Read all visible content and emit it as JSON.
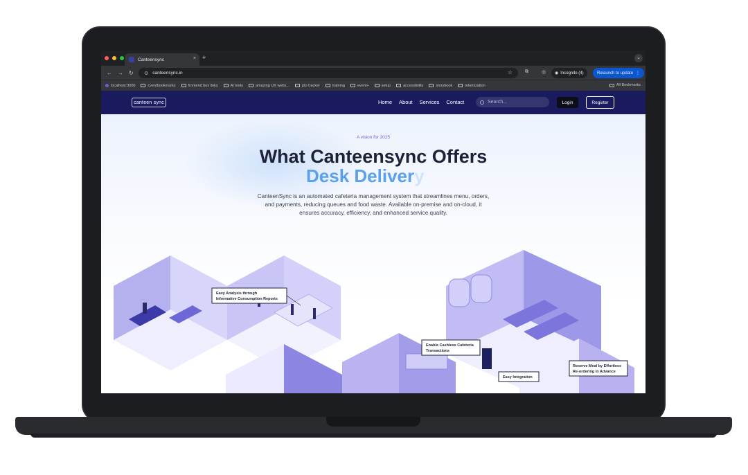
{
  "browser": {
    "tab_title": "Canteensync",
    "new_tab": "+",
    "tab_close": "×",
    "url": "canteensync.in",
    "incognito_label": "Incognito (4)",
    "relaunch_label": "Relaunch to update",
    "bookmarks": [
      {
        "label": "localhost:3000"
      },
      {
        "label": "cventbookmarks"
      },
      {
        "label": "frontend box links"
      },
      {
        "label": "AI tools"
      },
      {
        "label": "amazing UX webs..."
      },
      {
        "label": "pto tracker"
      },
      {
        "label": "training"
      },
      {
        "label": "event+"
      },
      {
        "label": "setup"
      },
      {
        "label": "accessibility"
      },
      {
        "label": "storybook"
      },
      {
        "label": "tokenization"
      }
    ],
    "all_bookmarks": "All Bookmarks"
  },
  "site": {
    "logo": "canteen sync",
    "nav": [
      "Home",
      "About",
      "Services",
      "Contact"
    ],
    "search_placeholder": "Search...",
    "login": "Login",
    "register": "Register",
    "eyebrow": "A vision for 2025",
    "headline": "What Canteensync Offers",
    "rotating_word": "Desk Deliver",
    "rotating_word_fade": "y",
    "description": "CanteenSync is an automated cafeteria management system that streamlines menu, orders, and payments, reducing queues and food waste. Available on-premise and on-cloud, it ensures accuracy, efficiency, and enhanced service quality.",
    "callouts": {
      "analysis": [
        "Easy Analysis through",
        "Informative Consumption Reports"
      ],
      "cashless": [
        "Enable Cashless Cafeteria",
        "Transactions"
      ],
      "integration": "Easy Integration",
      "reserve": [
        "Reserve Meal by Effortless",
        "Re-ordering in Advance"
      ]
    }
  },
  "colors": {
    "nav_bg": "#1a1a5e",
    "accent_blue": "#5aa0ec",
    "accent_purple": "#6c63d6",
    "illustration": "#8b85e0"
  }
}
